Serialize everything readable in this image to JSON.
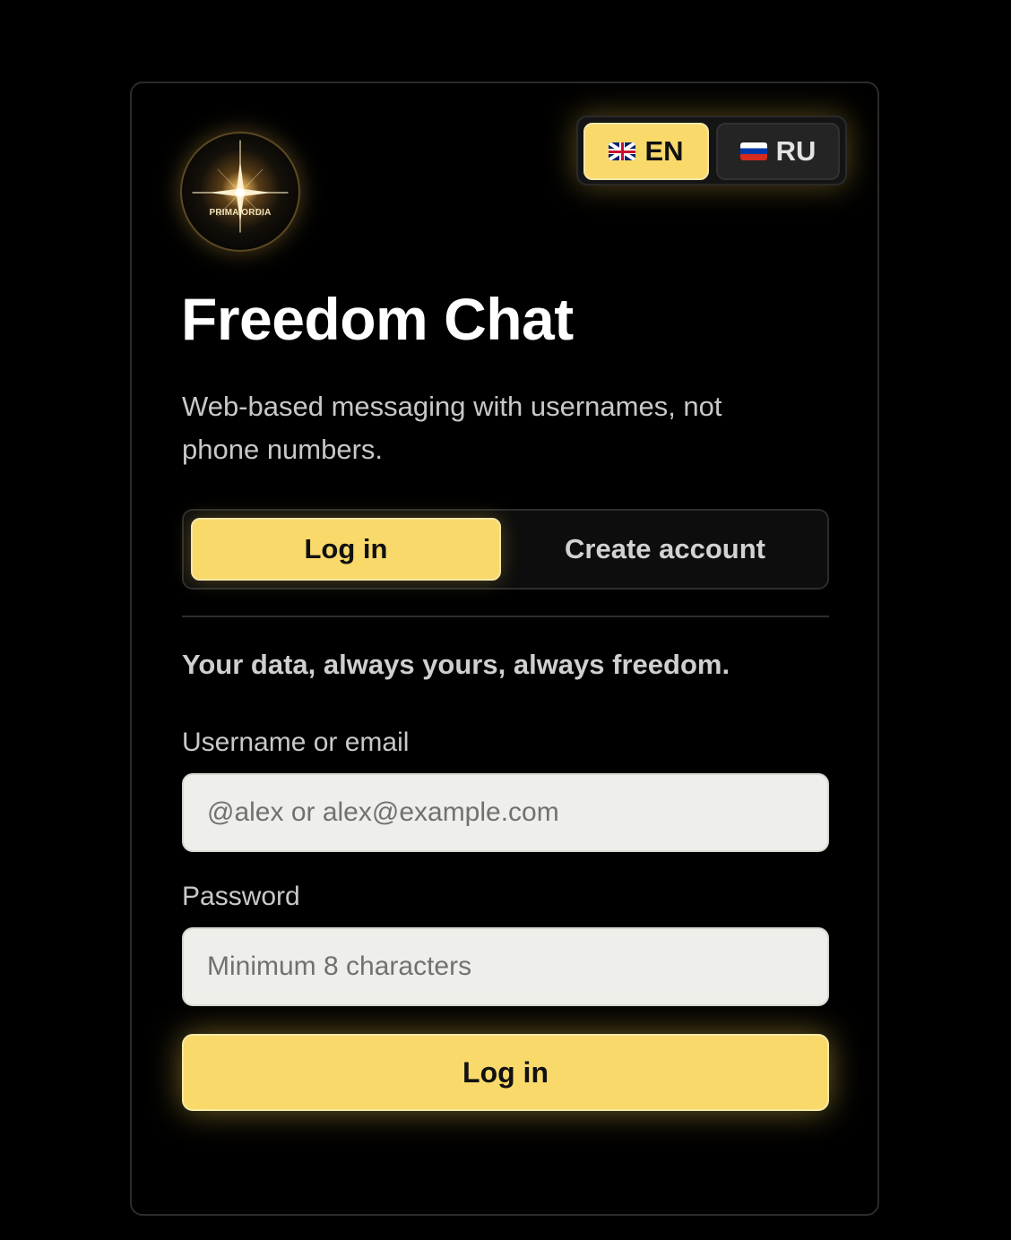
{
  "app": {
    "title": "Freedom Chat",
    "subtitle": "Web-based messaging with usernames, not phone numbers.",
    "logo_text": "PRIMA ORDIA",
    "logo_icon": "star-burst-icon"
  },
  "language_switch": {
    "options": [
      {
        "code": "EN",
        "flag_icon": "uk-flag-icon",
        "selected": true
      },
      {
        "code": "RU",
        "flag_icon": "russia-flag-icon",
        "selected": false
      }
    ]
  },
  "auth_tabs": {
    "login_label": "Log in",
    "create_label": "Create account",
    "active": "Log in"
  },
  "form": {
    "tagline": "Your data, always yours, always freedom.",
    "username": {
      "label": "Username or email",
      "placeholder": "@alex or alex@example.com",
      "value": ""
    },
    "password": {
      "label": "Password",
      "placeholder": "Minimum 8 characters",
      "value": ""
    },
    "submit_label": "Log in"
  },
  "colors": {
    "accent": "#f8d96a",
    "background": "#000000",
    "card_border": "#2b2b2b",
    "input_bg": "#eeeeea"
  }
}
